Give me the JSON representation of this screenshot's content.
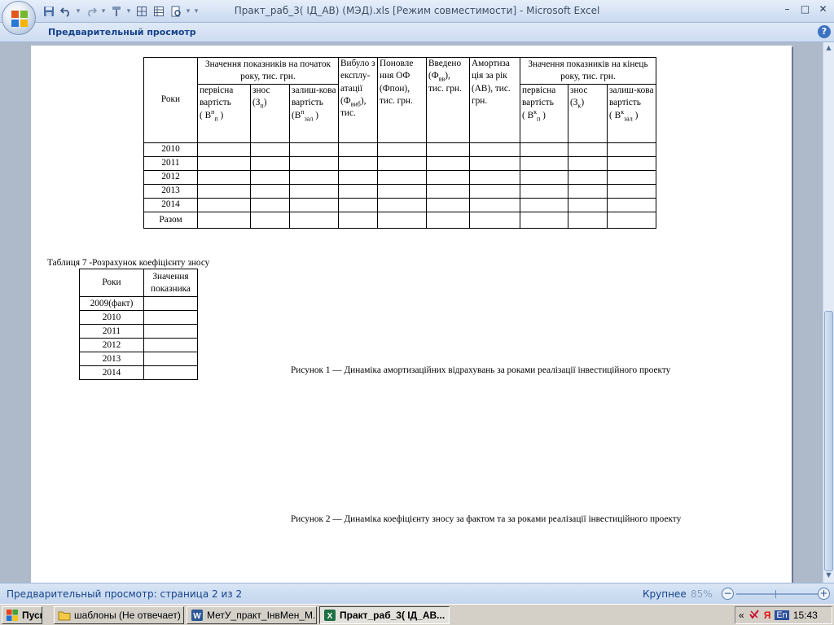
{
  "window": {
    "title": "Практ_раб_3( ІД_АВ) (МЭД).xls  [Режим совместимости] - Microsoft Excel",
    "controls": [
      "–",
      "□",
      "✕"
    ]
  },
  "quick_access": {
    "customize_glyph": "▾"
  },
  "ribbon": {
    "label": "Предварительный просмотр",
    "help_glyph": "?"
  },
  "table1": {
    "header": {
      "years": "Роки",
      "start_group": "Значення показників на початок року, тис. грн.",
      "start_initial": "первісна вартість",
      "start_initial_var": "( В",
      "start_initial_sup": "п",
      "start_initial_sub": "п",
      "start_initial_close": ")",
      "start_wear": "знос",
      "start_wear_var": "(З",
      "start_wear_sub": "п",
      "start_wear_close": ")",
      "start_residual": "залиш-кова вартість",
      "start_residual_var": "(В",
      "start_residual_sup": "п",
      "start_residual_sub": "зал",
      "start_residual_close": ")",
      "disposed_1": "Вибуло з експлу-атації",
      "disposed_var": "(Ф",
      "disposed_sub": "виб",
      "disposed_2": "),",
      "disposed_3": "тис.",
      "renewal": "Поновле ння ОФ (Фпон), тис. грн.",
      "introduced_var": "(Ф",
      "introduced_sub": "вв",
      "introduced_1": "Введено",
      "introduced_2": "), тис. грн.",
      "depreciation": "Амортиза ція за рік (АВ), тис. грн.",
      "end_group": "Значення показників на кінець року, тис. грн.",
      "end_initial": "первісна вартість",
      "end_initial_var": "( В",
      "end_initial_sup": "к",
      "end_initial_sub": "п",
      "end_initial_close": ")",
      "end_wear": "знос",
      "end_wear_var": "(З",
      "end_wear_sub": "к",
      "end_wear_close": ")",
      "end_residual": "залиш-кова вартість",
      "end_residual_var": "( В",
      "end_residual_sup": "к",
      "end_residual_sub": "зал",
      "end_residual_close": ")"
    },
    "rows": [
      "2010",
      "2011",
      "2012",
      "2013",
      "2014",
      "Разом"
    ]
  },
  "table7": {
    "caption": "Таблиця 7 -Розрахунок коефіцієнту зносу",
    "col_years": "Роки",
    "col_value": "Значення показника",
    "rows": [
      "2009(факт)",
      "2010",
      "2011",
      "2012",
      "2013",
      "2014"
    ]
  },
  "figures": {
    "fig1": "Рисунок 1 — Динаміка амортизаційних відрахувань за роками реалізації інвестиційного проекту",
    "fig2": "Рисунок 2 — Динаміка коефіцієнту зносу за фактом та за роками реалізації інвестиційного проекту"
  },
  "statusbar": {
    "text": "Предварительный просмотр: страница 2 из 2",
    "zoom_label": "Крупнее",
    "zoom_pct": "85%",
    "zoom_out": "−",
    "zoom_in": "+"
  },
  "taskbar": {
    "start": "Пуск",
    "buttons": [
      {
        "label": "шаблоны (Не отвечает)",
        "icon": "folder-icon"
      },
      {
        "label": "МетУ_практ_ІнвМен_М...",
        "icon": "word-icon"
      },
      {
        "label": "Практ_раб_3( ІД_АВ...",
        "icon": "excel-icon"
      }
    ],
    "tray_chevron": "«",
    "lang": "En",
    "clock": "15:43"
  }
}
